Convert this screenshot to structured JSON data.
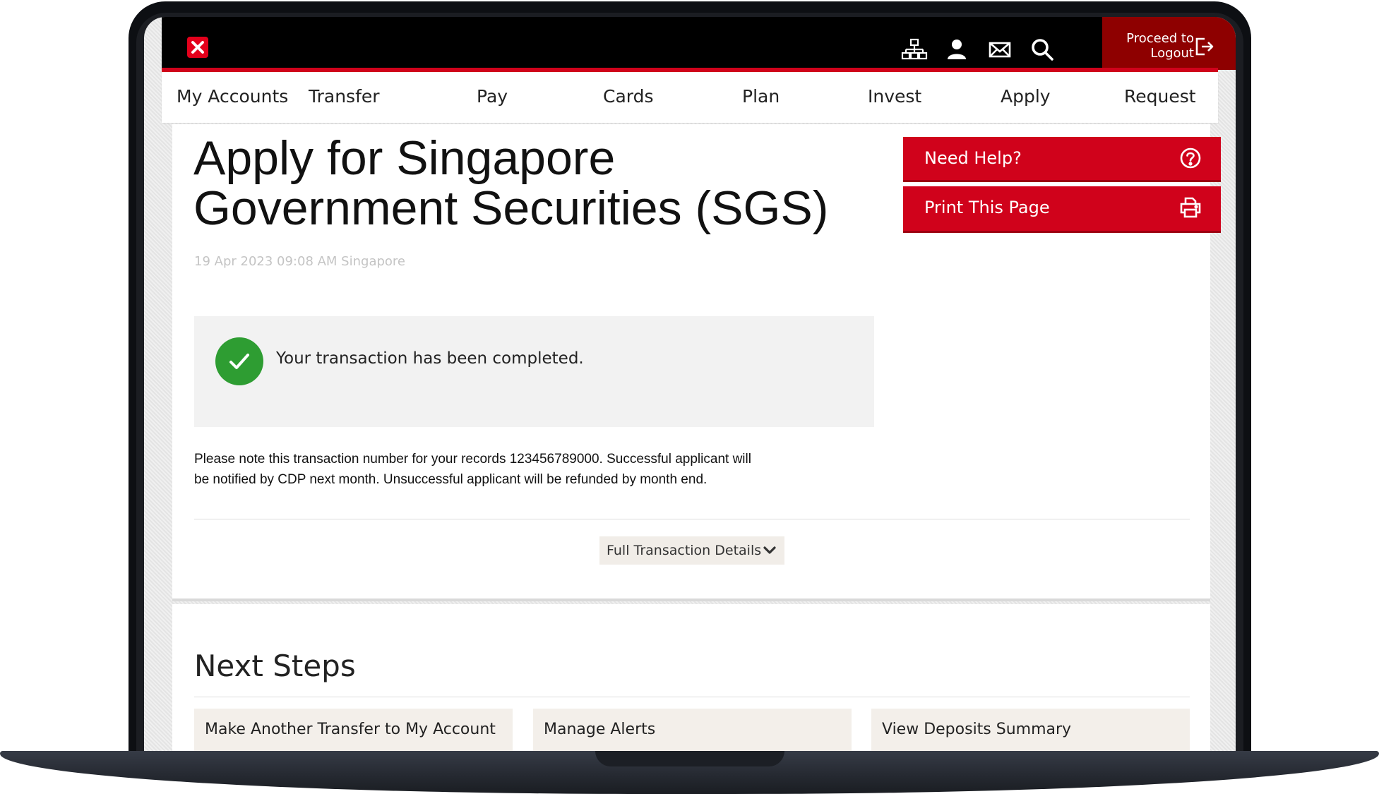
{
  "header": {
    "logout_line1": "Proceed to",
    "logout_line2": "Logout",
    "icons": [
      "sitemap-icon",
      "user-icon",
      "mail-icon",
      "search-icon",
      "logout-icon"
    ]
  },
  "nav": {
    "items": [
      "My Accounts",
      "Transfer",
      "Pay",
      "Cards",
      "Plan",
      "Invest",
      "Apply",
      "Request"
    ]
  },
  "page": {
    "title_line1": "Apply for Singapore",
    "title_line2": "Government Securities (SGS)",
    "timestamp": "19 Apr 2023 09:08 AM Singapore"
  },
  "sidebar": {
    "help_label": "Need Help?",
    "print_label": "Print This Page"
  },
  "status": {
    "message": "Your transaction has been completed.",
    "note_line1": "Please note this transaction number for your records 123456789000. Successful applicant will",
    "note_line2": "be notified by CDP next month. Unsuccessful applicant will be refunded by month end.",
    "details_label": "Full Transaction Details"
  },
  "next_steps": {
    "title": "Next Steps",
    "items": [
      "Make Another Transfer to My Account",
      "Manage Alerts",
      "View Deposits Summary"
    ]
  },
  "colors": {
    "brand_red": "#d0021b",
    "dark_red": "#8e0000",
    "success_green": "#2e9d32"
  }
}
